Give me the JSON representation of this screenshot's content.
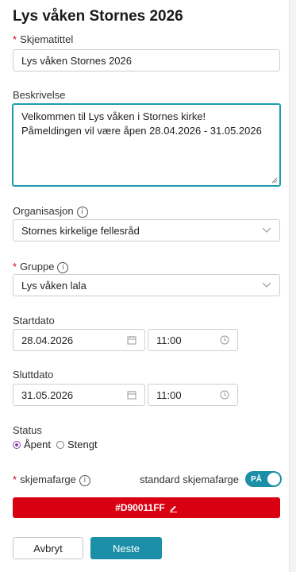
{
  "page": {
    "title": "Lys våken Stornes 2026"
  },
  "form": {
    "title_field": {
      "label": "Skjematittel",
      "value": "Lys våken Stornes 2026"
    },
    "description_field": {
      "label": "Beskrivelse",
      "line1": "Velkommen til Lys våken i Stornes kirke!",
      "line2": "Påmeldingen vil være åpen 28.04.2026 - 31.05.2026"
    },
    "organization_field": {
      "label": "Organisasjon",
      "value": "Stornes kirkelige fellesråd"
    },
    "group_field": {
      "label": "Gruppe",
      "value": "Lys våken lala"
    },
    "start": {
      "label": "Startdato",
      "date": "28.04.2026",
      "time": "11:00"
    },
    "end": {
      "label": "Sluttdato",
      "date": "31.05.2026",
      "time": "11:00"
    },
    "status": {
      "label": "Status",
      "option_open": "Åpent",
      "option_closed": "Stengt"
    },
    "color": {
      "label": "skjemafarge",
      "standard_label": "standard skjemafarge",
      "toggle_text": "PÅ",
      "value": "#D90011FF",
      "swatch": "#d90011"
    },
    "required_mark": "*",
    "info_glyph": "i"
  },
  "actions": {
    "cancel_label": "Avbryt",
    "next_label": "Neste"
  },
  "colors": {
    "accent": "#1b8ea8",
    "required": "#d9001b",
    "radio": "#8b3fa6"
  }
}
